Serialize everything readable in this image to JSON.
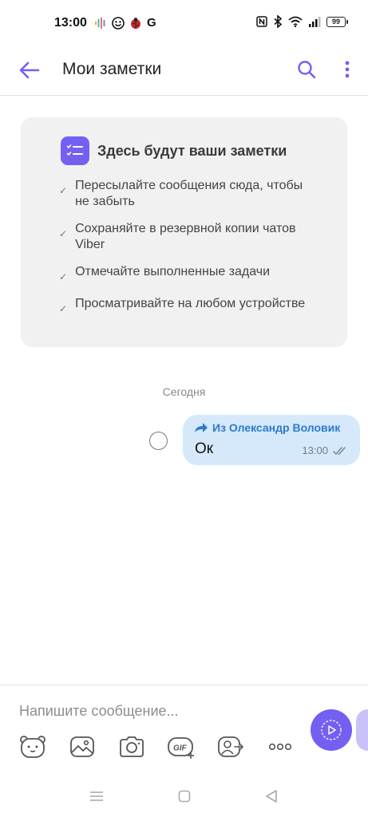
{
  "status_bar": {
    "time": "13:00",
    "notif_letter": "G",
    "battery": "99"
  },
  "header": {
    "title": "Мои заметки"
  },
  "notes_card": {
    "title": "Здесь будут ваши заметки",
    "items": [
      {
        "text": "Пересылайте сообщения сюда, чтобы не забыть"
      },
      {
        "text": "Сохраняйте в резервной копии чатов Viber"
      },
      {
        "text": "Отмечайте выполненные задачи"
      },
      {
        "text": "Просматривайте на любом устройстве"
      }
    ]
  },
  "date_divider": "Сегодня",
  "message": {
    "forwarded_from": "Из Олександр Воловик",
    "text": "Ок",
    "time": "13:00"
  },
  "composer": {
    "placeholder": "Напишите сообщение..."
  },
  "colors": {
    "accent": "#7360f2",
    "bubble": "#d5e9fb",
    "forward_link": "#2e79c9"
  }
}
